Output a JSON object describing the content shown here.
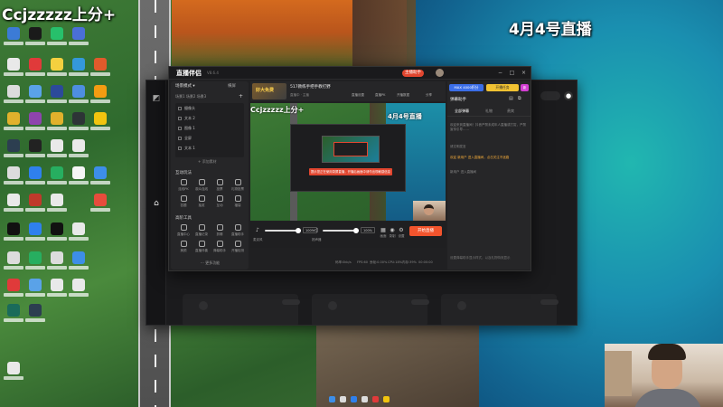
{
  "overlay": {
    "streamer_title": "Ccjzzzzz上分+",
    "stream_date": "4月4号直播"
  },
  "app": {
    "name": "直播伴侣",
    "version": "V8.6.4",
    "login_badge": "主播助手",
    "window_controls": [
      "−",
      "□",
      "×"
    ],
    "rail_logo": "◩",
    "home_icon": "⌂"
  },
  "left_panel": {
    "scene_header": "场景模式 ▾",
    "scene_mode": "横屏",
    "scene_tabs": "场景1   场景2   场景3",
    "add_icon": "+",
    "sources": [
      {
        "label": "摄像头"
      },
      {
        "label": "文本 2"
      },
      {
        "label": "图像 1"
      },
      {
        "label": "全屏"
      },
      {
        "label": "文本 1"
      }
    ],
    "add_source": "+ 添加素材",
    "interaction_title": "互动玩法",
    "interaction_tools": [
      "连线PK",
      "观众连线",
      "投票",
      "礼物投票",
      "答题",
      "抽奖",
      "互动",
      "福袋"
    ],
    "advanced_title": "高阶工具",
    "advanced_tools": [
      "直播中心",
      "直播记录",
      "剪辑",
      "直播助手",
      "美颜",
      "直播伴奏",
      "弹幕助手",
      "开播检测"
    ],
    "more_tools": "··· 更多功能"
  },
  "preview_top": {
    "thumb_label": "好大免费",
    "title": "517教练手把手教打野",
    "subtitle": "直播中 · 主播",
    "actions": [
      "直播设置",
      "直播PK",
      "开播数据",
      "分享"
    ]
  },
  "preview": {
    "streamer_title": "Ccjzzzzz上分+",
    "date": "4月4号直播",
    "warning": "提示您正在使用录屏直播，开播后画面中请勿出现敏感信息"
  },
  "audio": {
    "speaker_icon": "♪",
    "speaker_label": "麦克风",
    "speaker_pct": "100%",
    "mic_icon": "◁",
    "mic_label": "扬声器",
    "mic_pct": "100%",
    "buttons": [
      {
        "icon": "▦",
        "label": "画面"
      },
      {
        "icon": "◉",
        "label": "录制"
      },
      {
        "icon": "⚙",
        "label": "设置"
      }
    ],
    "go_live": "开始直播"
  },
  "status_bar": [
    "码率:0kb/s",
    "FPS:60",
    "丢帧:0.00%",
    "CPU:18%",
    "内存:39%",
    "00:00:00"
  ],
  "right_panel": {
    "vip_badge": "MAX  4000积分",
    "task_badge": "开播任务",
    "new_badge": "新",
    "chat_title": "弹幕助手",
    "tabs": [
      "全部弹幕",
      "礼物",
      "贵宾"
    ],
    "messages": [
      "欢迎来到直播间！抖音严禁未成年人直播或打赏，严禁宣传引导……",
      "请文明发言",
      "欢迎 新用户 进入直播间，点击关注不迷路",
      "新用户 进入直播间"
    ],
    "footer": "设置弹幕助手显示样式，以及礼物特效显示"
  }
}
